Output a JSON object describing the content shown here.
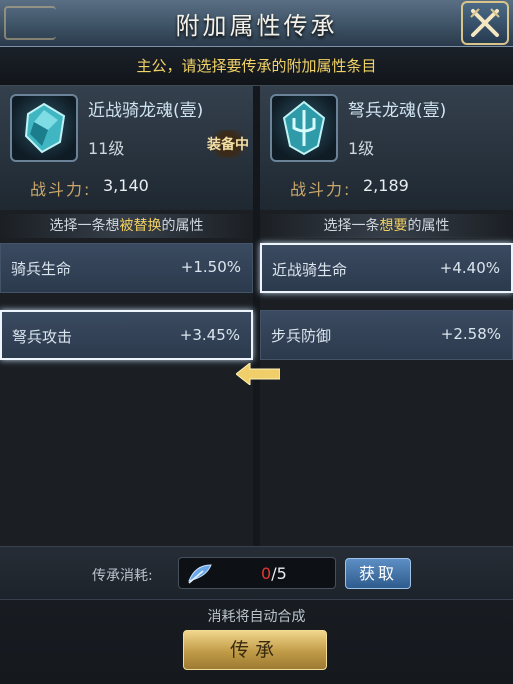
{
  "header": {
    "title": "附加属性传承"
  },
  "instruction": "主公，请选择要传承的附加属性条目",
  "left": {
    "name": "近战骑龙魂(壹)",
    "level": "11级",
    "power_label": "战斗力:",
    "power_value": "3,140",
    "equipped_badge": "装备中",
    "hint": {
      "before": "选择一条想",
      "highlight": "被替换",
      "after": "的属性"
    },
    "attributes": [
      {
        "name": "骑兵生命",
        "value": "+1.50%",
        "selected": false
      },
      {
        "name": "弩兵攻击",
        "value": "+3.45%",
        "selected": true
      }
    ]
  },
  "right": {
    "name": "弩兵龙魂(壹)",
    "level": "1级",
    "power_label": "战斗力:",
    "power_value": "2,189",
    "hint": {
      "before": "选择一条",
      "highlight": "想要",
      "after": "的属性"
    },
    "attributes": [
      {
        "name": "近战骑生命",
        "value": "+4.40%",
        "selected": true
      },
      {
        "name": "步兵防御",
        "value": "+2.58%",
        "selected": false
      }
    ]
  },
  "cost": {
    "label": "传承消耗:",
    "current": "0",
    "total": "/5",
    "get_label": "获取"
  },
  "auto_note": "消耗将自动合成",
  "inherit_label": "传承",
  "colors": {
    "accent_gold": "#f0d266",
    "insufficient_red": "#e1382e",
    "button_blue": "#2e5b8d"
  },
  "icons": {
    "close": "crossed-swords-icon",
    "left_item": "cyan-gem-icon",
    "right_item": "trident-gem-icon",
    "cost_item": "feather-material-icon",
    "transfer": "left-arrow-icon"
  }
}
